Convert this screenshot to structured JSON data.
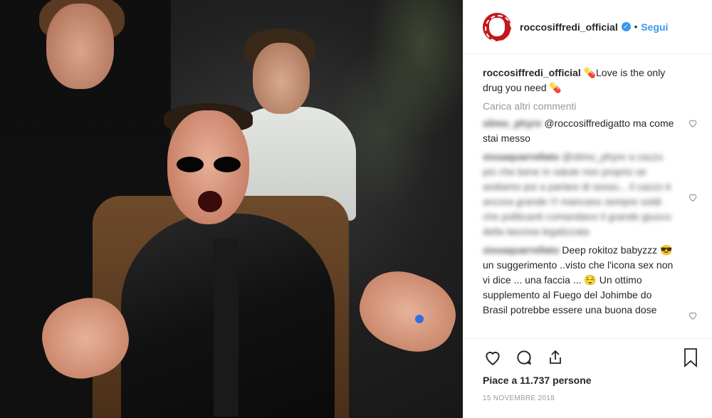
{
  "post": {
    "username": "roccosiffredi_official",
    "verified": "✓",
    "dot": "•",
    "follow_label": "Segui"
  },
  "caption": {
    "username": "roccosiffredi_official",
    "text": "💊Love is the only drug you need 💊"
  },
  "load_more": "Carica altri commenti",
  "comments": [
    {
      "username": "slimo_phyre",
      "text": "@roccosiffredigatto ma come stai messo"
    },
    {
      "username": "sissaquarrellato",
      "text": "@slimo_phyre a cazzo più che bene in salute non proprio se andiamo poi a parlare di sesso... il cazzo è ancora grande !!! mancano sempre soldi che politicanti comandano il grande giuoco della lascivia legalizzata"
    },
    {
      "username": "sissaquarrellato",
      "text": "Deep rokitoz babyzzz 😎 un suggerimento ..visto che l'icona sex non vi dice ... una faccia ... 😌 Un ottimo supplemento al Fuego del Johimbe do Brasil potrebbe essere una buona dose"
    }
  ],
  "likes": "Piace a 11.737 persone",
  "date": "15 NOVEMBRE 2018"
}
